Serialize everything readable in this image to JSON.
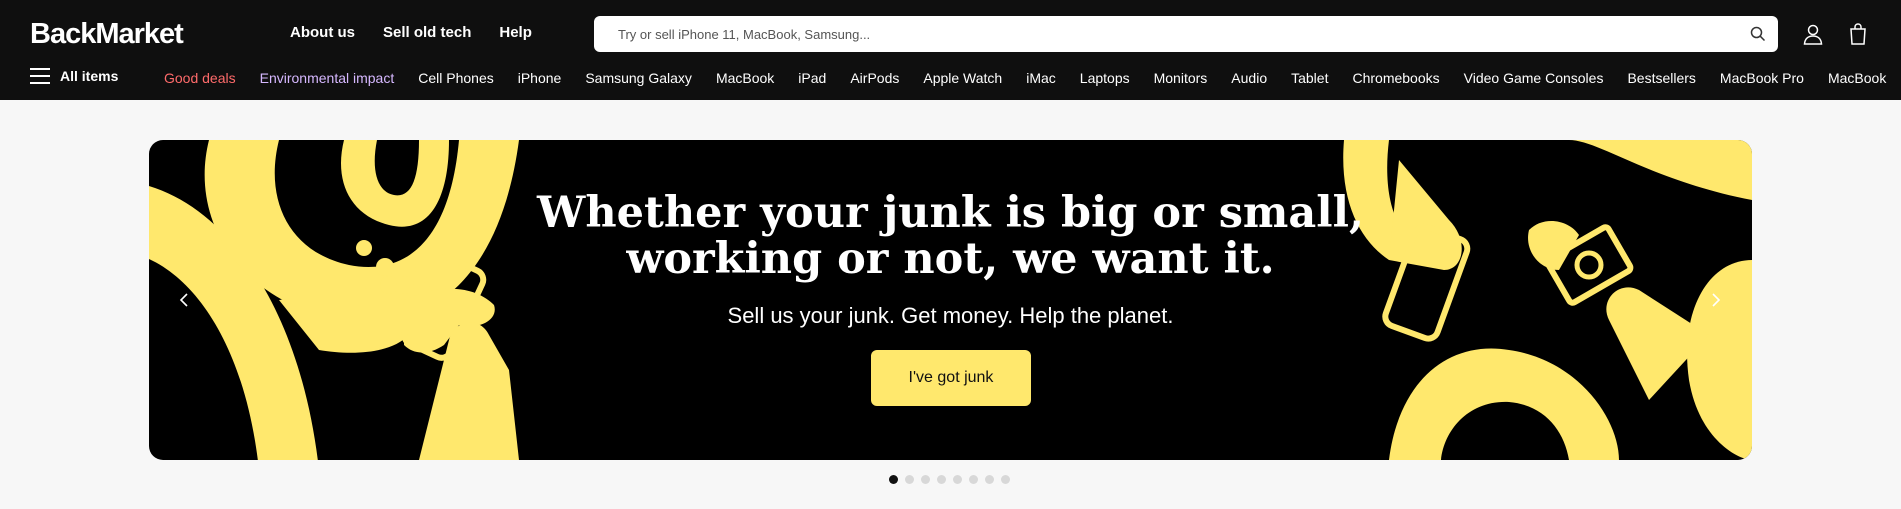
{
  "header": {
    "logo": "BackMarket",
    "links": [
      "About us",
      "Sell old tech",
      "Help"
    ],
    "search_placeholder": "Try or sell iPhone 11, MacBook, Samsung...",
    "icons": [
      "search-icon",
      "account-icon",
      "shopping-bag-icon"
    ]
  },
  "nav": {
    "all_items": "All items",
    "links": [
      "Good deals",
      "Environmental impact",
      "Cell Phones",
      "iPhone",
      "Samsung Galaxy",
      "MacBook",
      "iPad",
      "AirPods",
      "Apple Watch",
      "iMac",
      "Laptops",
      "Monitors",
      "Audio",
      "Tablet",
      "Chromebooks",
      "Video Game Consoles",
      "Bestsellers",
      "MacBook Pro",
      "MacBook"
    ],
    "link_colors": {
      "Good deals": "#ff6b6b",
      "Environmental impact": "#d6b8ff"
    }
  },
  "banner": {
    "headline_line1": "Whether your junk is big or small,",
    "headline_line2": "working or not, we want it.",
    "subline": "Sell us your junk. Get money. Help the planet.",
    "cta": "I've got junk",
    "accent": "#ffe86d"
  },
  "carousel": {
    "slide_count": 8,
    "active_index": 0
  }
}
